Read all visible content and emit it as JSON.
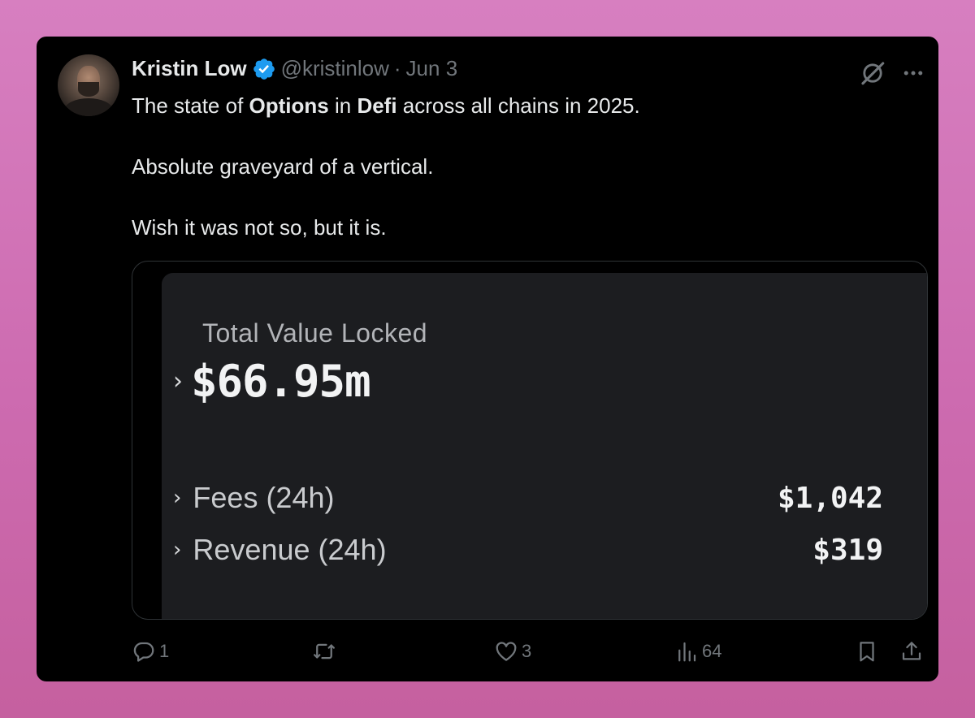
{
  "tweet": {
    "author_name": "Kristin Low",
    "handle": "@kristinlow",
    "separator": "·",
    "date": "Jun 3",
    "text": {
      "line1_part1": "The state of ",
      "line1_bold1": "Options",
      "line1_part2": " in ",
      "line1_bold2": "Defi",
      "line1_part3": " across all chains in 2025.",
      "line2": "Absolute graveyard of a vertical.",
      "line3": "Wish it was not so, but it is."
    }
  },
  "media": {
    "tvl_label": "Total Value Locked",
    "tvl_value": "$66.95m",
    "fees_label": "Fees (24h)",
    "fees_value": "$1,042",
    "revenue_label": "Revenue (24h)",
    "revenue_value": "$319",
    "chevron": "›"
  },
  "actions": {
    "reply_count": "1",
    "repost_count": "",
    "like_count": "3",
    "views_count": "64"
  },
  "icons": {
    "verified": "verified-badge-icon",
    "grok": "grok-icon",
    "more": "more-icon",
    "reply": "reply-icon",
    "repost": "repost-icon",
    "like": "heart-icon",
    "views": "views-icon",
    "bookmark": "bookmark-icon",
    "share": "share-icon"
  },
  "colors": {
    "background": "#d77fc0",
    "card": "#000000",
    "verified": "#1d9bf0",
    "muted": "#71767b",
    "text": "#e7e9ea",
    "panel": "#1c1d20"
  }
}
